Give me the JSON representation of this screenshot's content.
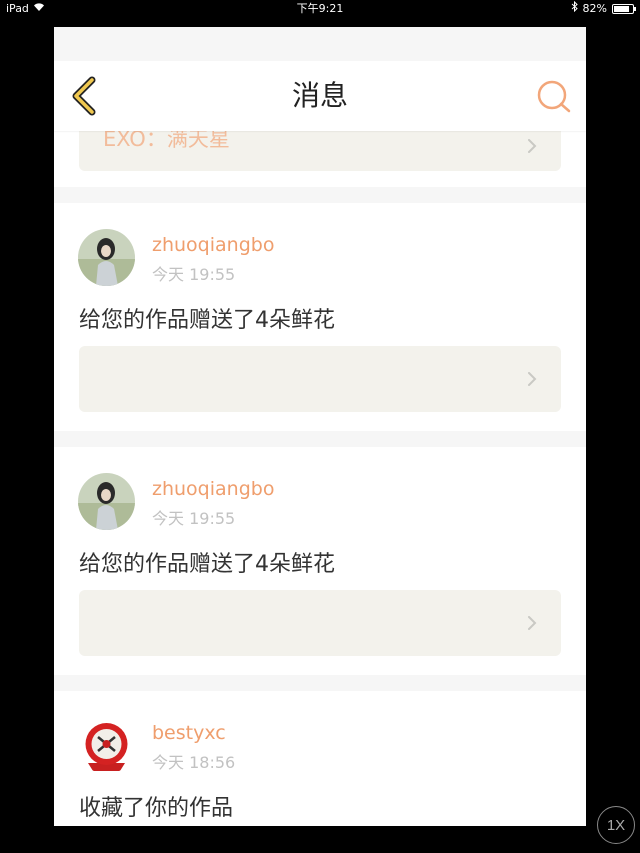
{
  "status_bar": {
    "device": "iPad",
    "time": "下午9:21",
    "battery": "82%",
    "battery_level": 0.82
  },
  "nav": {
    "title": "消息",
    "back_icon": "chevron-left-icon",
    "search_icon": "search-icon"
  },
  "partial_card": {
    "text": "EXO：满天星"
  },
  "notifications": [
    {
      "username": "zhuoqiangbo",
      "time": "今天 19:55",
      "message": "给您的作品赠送了4朵鲜花"
    },
    {
      "username": "zhuoqiangbo",
      "time": "今天 19:55",
      "message": "给您的作品赠送了4朵鲜花"
    },
    {
      "username": "bestyxc",
      "time": "今天 18:56",
      "message": "收藏了你的作品"
    }
  ],
  "zoom": {
    "label": "1X"
  },
  "colors": {
    "accent": "#ef9e6d",
    "link_bg": "#f3f2ec",
    "back_arrow": "#f0c850"
  }
}
